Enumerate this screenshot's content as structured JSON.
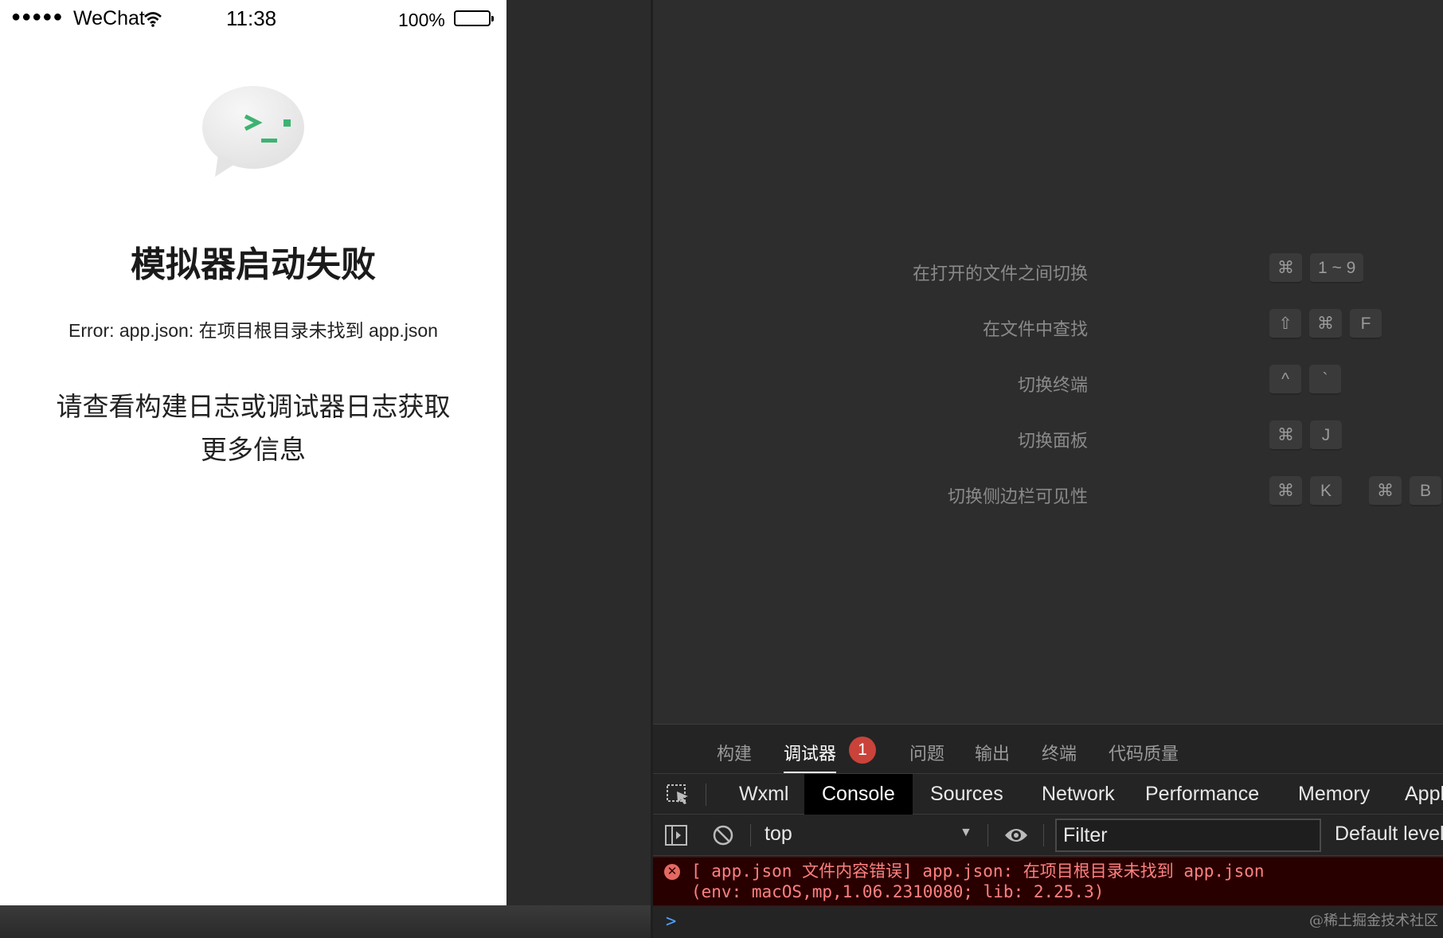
{
  "simulator": {
    "status_bar": {
      "signal": "●●●●●",
      "carrier": "WeChat",
      "time": "11:38",
      "battery_percent": "100%"
    },
    "error_title": "模拟器启动失败",
    "error_message": "Error: app.json: 在项目根目录未找到 app.json",
    "hint_line1": "请查看构建日志或调试器日志获取",
    "hint_line2": "更多信息"
  },
  "shortcuts": [
    {
      "label": "在打开的文件之间切换",
      "keys": [
        "⌘",
        "1 ~ 9"
      ]
    },
    {
      "label": "在文件中查找",
      "keys": [
        "⇧",
        "⌘",
        "F"
      ]
    },
    {
      "label": "切换终端",
      "keys": [
        "^",
        "`"
      ]
    },
    {
      "label": "切换面板",
      "keys": [
        "⌘",
        "J"
      ]
    },
    {
      "label": "切换侧边栏可见性",
      "keys": [
        "⌘",
        "K",
        "⌘",
        "B"
      ]
    }
  ],
  "panel_tabs": [
    "构建",
    "调试器",
    "问题",
    "输出",
    "终端",
    "代码质量"
  ],
  "panel_active_tab": "调试器",
  "debugger_badge": "1",
  "devtools_tabs": [
    "Wxml",
    "Console",
    "Sources",
    "Network",
    "Performance",
    "Memory",
    "Appl"
  ],
  "devtools_active_tab": "Console",
  "console": {
    "context": "top",
    "filter_placeholder": "Filter",
    "levels": "Default levels",
    "error_line1": "[ app.json 文件内容错误] app.json: 在项目根目录未找到 app.json",
    "error_line2": "(env: macOS,mp,1.06.2310080; lib: 2.25.3)",
    "prompt": ">"
  },
  "watermark": "@稀土掘金技术社区",
  "colors": {
    "editor_bg": "#2d2d2d",
    "error_red": "#ff8080",
    "badge_red": "#c9433a",
    "wechat_green": "#3cb371"
  }
}
